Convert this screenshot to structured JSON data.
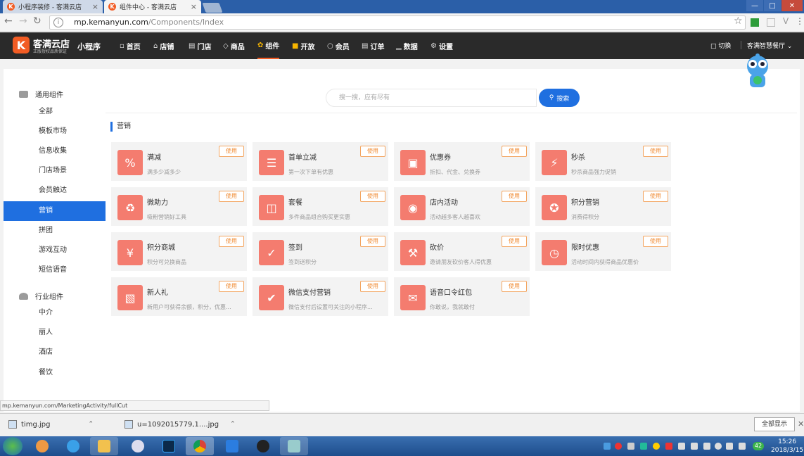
{
  "browser": {
    "tabs": [
      {
        "title": "小程序装修 - 客满云店",
        "close": "×",
        "favicon": "K"
      },
      {
        "title": "组件中心 - 客满云店",
        "close": "×",
        "favicon": "K"
      }
    ],
    "url_host": "mp.kemanyun.com",
    "url_path": "/Components/Index",
    "status_url": "mp.kemanyun.com/MarketingActivity/fullCut"
  },
  "header": {
    "logo_mark": "K",
    "logo_name": "客满云店",
    "logo_sub": "正版授权品质保证",
    "product": "小程序",
    "nav": [
      {
        "label": "首页",
        "icon": "message-icon"
      },
      {
        "label": "店铺",
        "icon": "home-icon"
      },
      {
        "label": "门店",
        "icon": "store-icon"
      },
      {
        "label": "商品",
        "icon": "tag-icon"
      },
      {
        "label": "组件",
        "icon": "components-icon"
      },
      {
        "label": "开放",
        "icon": "cube-icon"
      },
      {
        "label": "会员",
        "icon": "user-icon"
      },
      {
        "label": "订单",
        "icon": "order-icon"
      },
      {
        "label": "数据",
        "icon": "chart-icon"
      },
      {
        "label": "设置",
        "icon": "gear-icon"
      }
    ],
    "active_nav": "组件",
    "switch_label": "切换",
    "store_name": "客满智慧餐厅"
  },
  "sidebar": {
    "groups": [
      {
        "title": "通用组件",
        "items": [
          "全部",
          "模板市场",
          "信息收集",
          "门店场景",
          "会员触达",
          "营销",
          "拼团",
          "游戏互动",
          "短信语音"
        ]
      },
      {
        "title": "行业组件",
        "items": [
          "中介",
          "丽人",
          "酒店",
          "餐饮"
        ]
      }
    ],
    "active_item": "营销"
  },
  "search": {
    "placeholder": "搜一搜，应有尽有",
    "button": "搜索"
  },
  "section": {
    "title": "营销"
  },
  "use_label": "使用",
  "cards": [
    {
      "title": "满减",
      "desc": "满多少减多少",
      "icon": "percent-icon"
    },
    {
      "title": "首单立减",
      "desc": "第一次下单有优惠",
      "icon": "list-icon"
    },
    {
      "title": "优惠券",
      "desc": "折扣、代金、兑换券",
      "icon": "coupon-icon"
    },
    {
      "title": "秒杀",
      "desc": "秒杀商品强力促销",
      "icon": "lightning-icon"
    },
    {
      "title": "微助力",
      "desc": "吸粉营销好工具",
      "icon": "help-icon"
    },
    {
      "title": "套餐",
      "desc": "多件商品组合购买更实惠",
      "icon": "basket-icon"
    },
    {
      "title": "店内活动",
      "desc": "活动越多客人越喜欢",
      "icon": "balloon-icon"
    },
    {
      "title": "积分营销",
      "desc": "消费得积分",
      "icon": "points-icon"
    },
    {
      "title": "积分商城",
      "desc": "积分可兑换商品",
      "icon": "coins-icon"
    },
    {
      "title": "签到",
      "desc": "签到送积分",
      "icon": "calendar-check-icon"
    },
    {
      "title": "砍价",
      "desc": "邀请朋友砍价客人得优惠",
      "icon": "axe-icon"
    },
    {
      "title": "限时优惠",
      "desc": "活动时间内获得商品优惠价",
      "icon": "clock-icon"
    },
    {
      "title": "新人礼",
      "desc": "新用户可获得余额，积分，优惠...",
      "icon": "gift-icon"
    },
    {
      "title": "微信支付营销",
      "desc": "微信支付后设置可关注的小程序...",
      "icon": "wechat-pay-icon"
    },
    {
      "title": "语音口令红包",
      "desc": "你敢说，我就敢付",
      "icon": "voice-envelope-icon"
    }
  ],
  "downloads": [
    {
      "name": "timg.jpg"
    },
    {
      "name": "u=1092015779,1....jpg"
    }
  ],
  "show_all": "全部显示",
  "clock": {
    "time": "15:26",
    "date": "2018/3/15"
  },
  "tray_badge": "42"
}
